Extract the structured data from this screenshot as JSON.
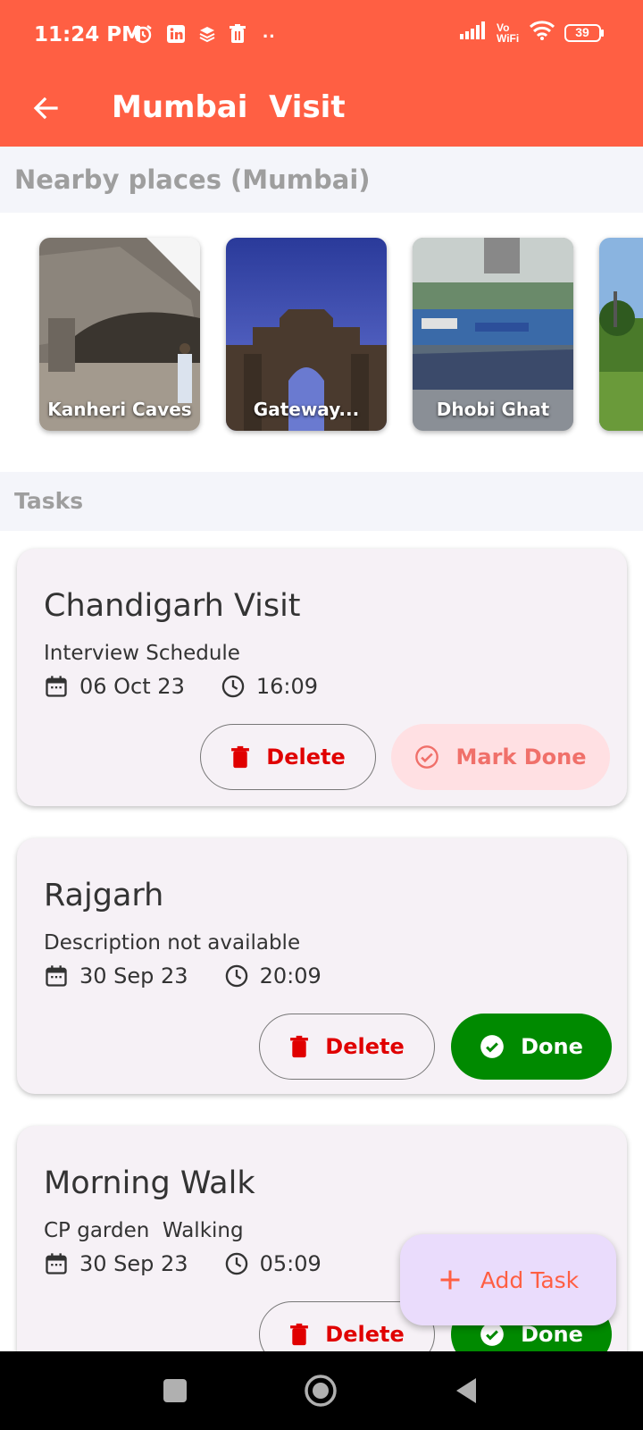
{
  "status_bar": {
    "time": "11:24 PM",
    "battery": "39",
    "network": "Vo WiFi"
  },
  "app_bar": {
    "title": "Mumbai  Visit"
  },
  "nearby": {
    "header": "Nearby places (Mumbai)",
    "places": [
      {
        "name": "Kanheri Caves"
      },
      {
        "name": "Gateway..."
      },
      {
        "name": "Dhobi Ghat"
      },
      {
        "name": ""
      }
    ]
  },
  "tasks": {
    "header": "Tasks",
    "items": [
      {
        "title": "Chandigarh Visit",
        "description": "Interview Schedule",
        "date": "06 Oct 23",
        "time": "16:09",
        "delete_label": "Delete",
        "status_label": "Mark Done",
        "done": false
      },
      {
        "title": "Rajgarh",
        "description": "Description not available",
        "date": "30 Sep 23",
        "time": "20:09",
        "delete_label": "Delete",
        "status_label": "Done",
        "done": true
      },
      {
        "title": "Morning Walk",
        "description": "CP garden  Walking",
        "date": "30 Sep 23",
        "time": "05:09",
        "delete_label": "Delete",
        "status_label": "Done",
        "done": true
      }
    ]
  },
  "fab": {
    "label": "Add Task"
  },
  "colors": {
    "accent": "#ff5f43",
    "done_green": "#008a00",
    "delete_red": "#e00000"
  }
}
